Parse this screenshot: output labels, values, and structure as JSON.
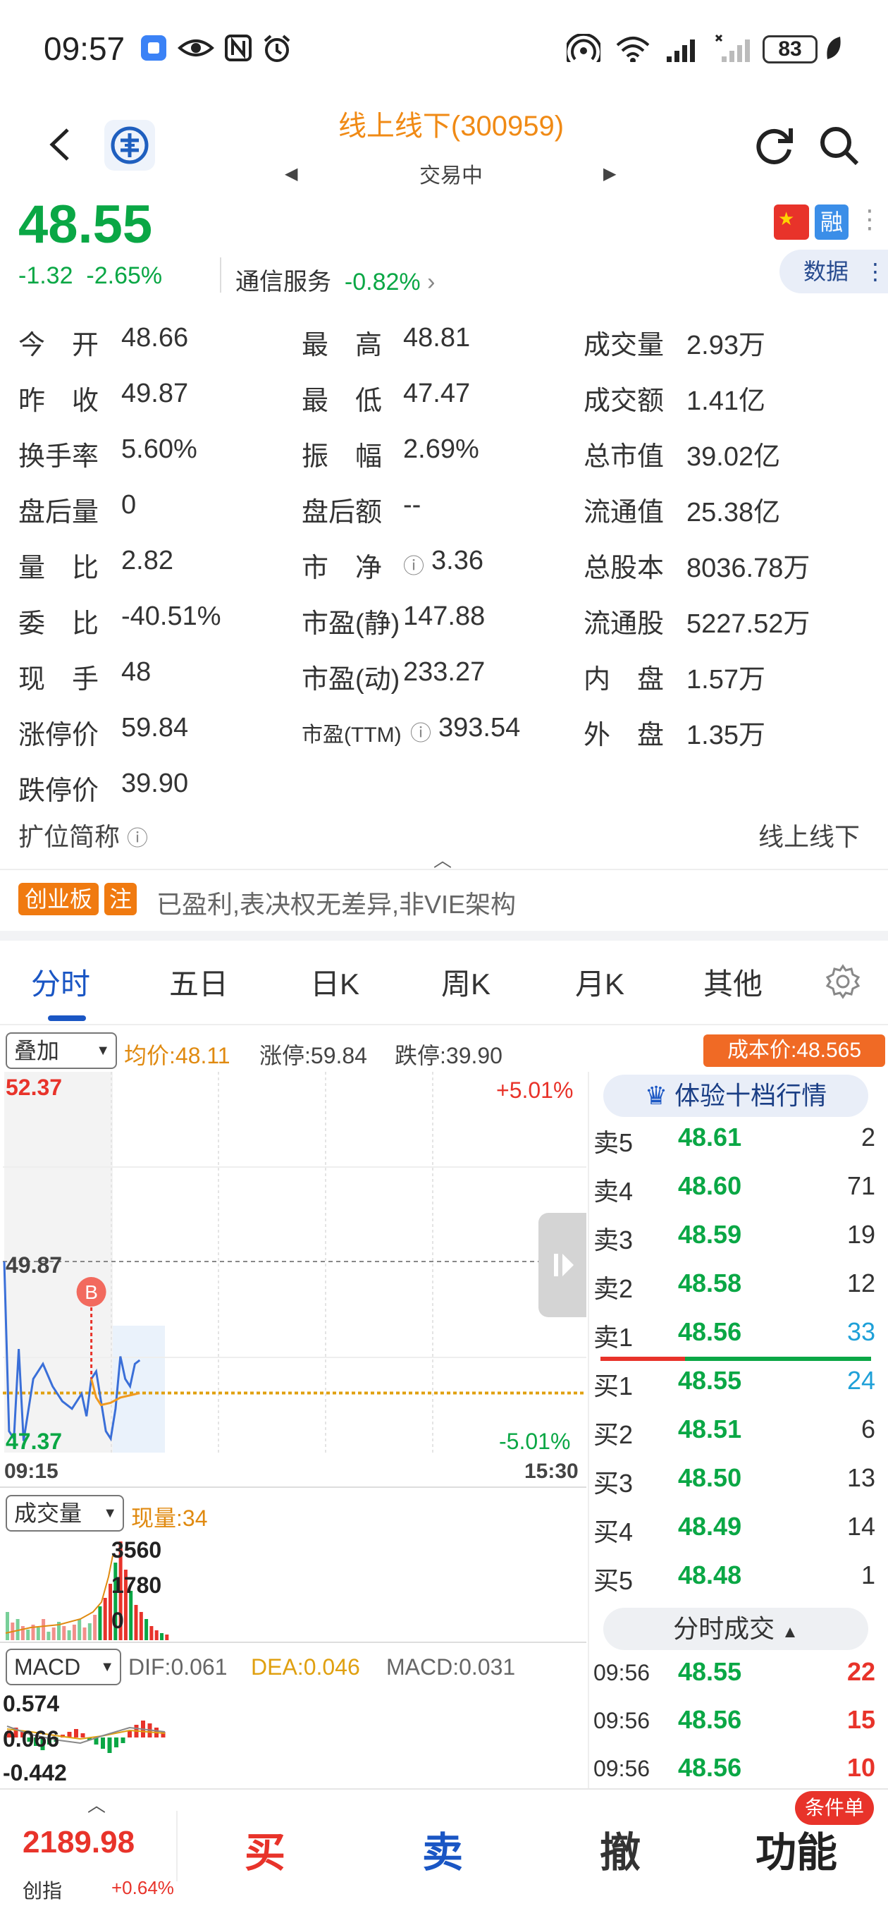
{
  "status_bar": {
    "time": "09:57",
    "battery": "83",
    "icons": [
      "app-notification-icon",
      "eye-icon",
      "nfc-icon",
      "alarm-icon",
      "hotspot-icon",
      "wifi-icon",
      "signal-icon",
      "signal-off-icon",
      "leaf-icon"
    ]
  },
  "header": {
    "title": "线上线下(300959)",
    "subtitle": "交易中"
  },
  "quote": {
    "price": "48.55",
    "change": "-1.32",
    "change_pct": "-2.65%",
    "industry": "通信服务",
    "industry_pct": "-0.82%",
    "rong": "融",
    "data_label": "数据"
  },
  "stats": [
    {
      "label": "今　开",
      "value": "48.66"
    },
    {
      "label": "最　高",
      "value": "48.81"
    },
    {
      "label": "成交量",
      "value": "2.93万"
    },
    {
      "label": "昨　收",
      "value": "49.87"
    },
    {
      "label": "最　低",
      "value": "47.47"
    },
    {
      "label": "成交额",
      "value": "1.41亿"
    },
    {
      "label": "换手率",
      "value": "5.60%"
    },
    {
      "label": "振　幅",
      "value": "2.69%"
    },
    {
      "label": "总市值",
      "value": "39.02亿"
    },
    {
      "label": "盘后量",
      "value": "0"
    },
    {
      "label": "盘后额",
      "value": "--"
    },
    {
      "label": "流通值",
      "value": "25.38亿"
    },
    {
      "label": "量　比",
      "value": "2.82"
    },
    {
      "label": "市　净",
      "value": "3.36"
    },
    {
      "label": "总股本",
      "value": "8036.78万"
    },
    {
      "label": "委　比",
      "value": "-40.51%"
    },
    {
      "label": "市盈(静)",
      "value": "147.88"
    },
    {
      "label": "流通股",
      "value": "5227.52万"
    },
    {
      "label": "现　手",
      "value": "48"
    },
    {
      "label": "市盈(动)",
      "value": "233.27"
    },
    {
      "label": "内　盘",
      "value": "1.57万"
    },
    {
      "label": "涨停价",
      "value": "59.84"
    },
    {
      "label": "市盈(TTM)",
      "value": "393.54"
    },
    {
      "label": "外　盘",
      "value": "1.35万"
    },
    {
      "label": "跌停价",
      "value": "39.90"
    }
  ],
  "expand": {
    "label": "扩位简称",
    "value": "线上线下"
  },
  "tags": [
    "创业板",
    "注"
  ],
  "tagline": "已盈利,表决权无差异,非VIE架构",
  "tabs": [
    "分时",
    "五日",
    "日K",
    "周K",
    "月K",
    "其他"
  ],
  "chart_info": {
    "overlay_label": "叠加",
    "avg": "均价:48.11",
    "limit_up": "涨停:59.84",
    "limit_down": "跌停:39.90",
    "cost": "成本价:48.565"
  },
  "chart_data": {
    "type": "line",
    "price_axis": {
      "top": "52.37",
      "mid": "49.87",
      "bottom": "47.37",
      "top_pct": "+5.01%",
      "bottom_pct": "-5.01%"
    },
    "time_axis": {
      "start": "09:15",
      "end": "15:30"
    },
    "marker": "B",
    "ylim": [
      47.37,
      52.37
    ],
    "prev_close": 49.87,
    "price_series": [
      {
        "t": 0,
        "v": 49.87
      },
      {
        "t": 1,
        "v": 47.6
      },
      {
        "t": 2,
        "v": 47.5
      },
      {
        "t": 3,
        "v": 48.7
      },
      {
        "t": 4,
        "v": 47.47
      },
      {
        "t": 6,
        "v": 48.3
      },
      {
        "t": 8,
        "v": 48.5
      },
      {
        "t": 10,
        "v": 48.2
      },
      {
        "t": 12,
        "v": 48.0
      },
      {
        "t": 14,
        "v": 47.9
      },
      {
        "t": 16,
        "v": 48.1
      },
      {
        "t": 17,
        "v": 47.8
      },
      {
        "t": 18,
        "v": 48.3
      },
      {
        "t": 19,
        "v": 48.4
      },
      {
        "t": 20,
        "v": 48.0
      },
      {
        "t": 21,
        "v": 47.6
      },
      {
        "t": 22,
        "v": 47.5
      },
      {
        "t": 23,
        "v": 47.9
      },
      {
        "t": 24,
        "v": 48.6
      },
      {
        "t": 25,
        "v": 48.3
      },
      {
        "t": 26,
        "v": 48.2
      },
      {
        "t": 27,
        "v": 48.5
      },
      {
        "t": 28,
        "v": 48.55
      }
    ],
    "avg_series": [
      {
        "t": 18,
        "v": 48.3
      },
      {
        "t": 19,
        "v": 48.05
      },
      {
        "t": 20,
        "v": 47.95
      },
      {
        "t": 22,
        "v": 47.98
      },
      {
        "t": 24,
        "v": 48.05
      },
      {
        "t": 26,
        "v": 48.08
      },
      {
        "t": 28,
        "v": 48.11
      }
    ],
    "t_max": 120,
    "volume": {
      "label": "成交量",
      "current": "现量:34",
      "ticks": [
        "3560",
        "1780",
        "0"
      ]
    },
    "macd": {
      "label": "MACD",
      "dif": "DIF:0.061",
      "dea": "DEA:0.046",
      "macd": "MACD:0.031",
      "ticks": [
        "0.574",
        "0.066",
        "-0.442"
      ]
    }
  },
  "order_book": {
    "vip_label": "体验十档行情",
    "asks": [
      {
        "label": "卖5",
        "price": "48.61",
        "vol": "2"
      },
      {
        "label": "卖4",
        "price": "48.60",
        "vol": "71"
      },
      {
        "label": "卖3",
        "price": "48.59",
        "vol": "19"
      },
      {
        "label": "卖2",
        "price": "48.58",
        "vol": "12"
      },
      {
        "label": "卖1",
        "price": "48.56",
        "vol": "33"
      }
    ],
    "bids": [
      {
        "label": "买1",
        "price": "48.55",
        "vol": "24"
      },
      {
        "label": "买2",
        "price": "48.51",
        "vol": "6"
      },
      {
        "label": "买3",
        "price": "48.50",
        "vol": "13"
      },
      {
        "label": "买4",
        "price": "48.49",
        "vol": "14"
      },
      {
        "label": "买5",
        "price": "48.48",
        "vol": "1"
      }
    ],
    "trades_label": "分时成交",
    "trades": [
      {
        "time": "09:56",
        "price": "48.55",
        "vol": "22"
      },
      {
        "time": "09:56",
        "price": "48.56",
        "vol": "15"
      },
      {
        "time": "09:56",
        "price": "48.56",
        "vol": "10"
      }
    ]
  },
  "bottom": {
    "index_value": "2189.98",
    "index_name": "创指",
    "index_change": "+0.64%",
    "buy": "买",
    "sell": "卖",
    "cancel": "撤",
    "func": "功能",
    "cond_order": "条件单"
  },
  "colors": {
    "up": "#e8332a",
    "down": "#0aa745",
    "accent": "#1a56c4",
    "orange": "#f08a15"
  }
}
